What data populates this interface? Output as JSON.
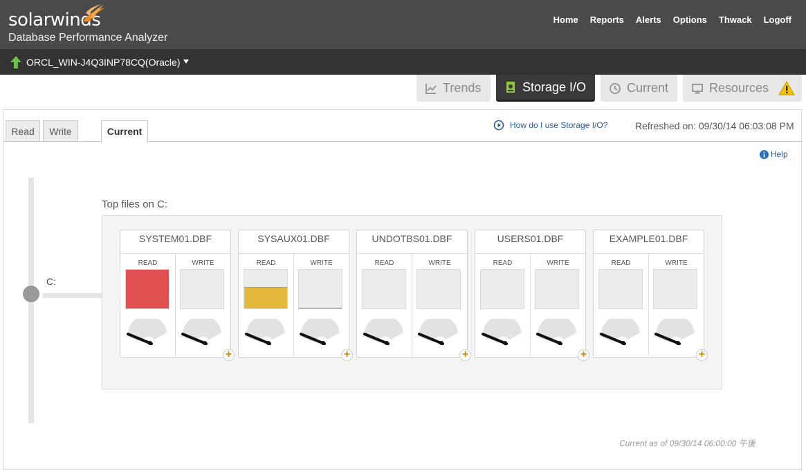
{
  "header": {
    "logo_text": "solarwinds",
    "app_name": "Database Performance Analyzer",
    "nav": [
      "Home",
      "Reports",
      "Alerts",
      "Options",
      "Thwack",
      "Logoff"
    ]
  },
  "server": {
    "name": "ORCL_WIN-J4Q3INP78CQ(Oracle)"
  },
  "main_tabs": {
    "trends": "Trends",
    "storage": "Storage I/O",
    "current": "Current",
    "resources": "Resources"
  },
  "sub_tabs": {
    "read": "Read",
    "write": "Write",
    "current": "Current"
  },
  "howto_link": "How do I use Storage I/O?",
  "refreshed": "Refreshed on: 09/30/14 06:03:08 PM",
  "help": "Help",
  "drive": {
    "label": "C:",
    "files_title": "Top files on C:"
  },
  "labels": {
    "read": "READ",
    "write": "WRITE"
  },
  "files": [
    {
      "name": "SYSTEM01.DBF",
      "read_level": 1.0,
      "read_color": "#e05050",
      "write_level": 0,
      "write_color": "#e05050"
    },
    {
      "name": "SYSAUX01.DBF",
      "read_level": 0.55,
      "read_color": "#e4b83a",
      "write_level": 0.02,
      "write_color": "#4caf50"
    },
    {
      "name": "UNDOTBS01.DBF",
      "read_level": 0,
      "read_color": "#e05050",
      "write_level": 0,
      "write_color": "#e05050"
    },
    {
      "name": "USERS01.DBF",
      "read_level": 0,
      "read_color": "#e05050",
      "write_level": 0,
      "write_color": "#e05050"
    },
    {
      "name": "EXAMPLE01.DBF",
      "read_level": 0,
      "read_color": "#e05050",
      "write_level": 0,
      "write_color": "#e05050"
    }
  ],
  "footer": {
    "current_as": "Current as of 09/30/14 06:00:00 午後"
  },
  "colors": {
    "header": "#4a4a4a",
    "serverbar": "#333333",
    "link": "#2a5c99",
    "accent": "#e8871e"
  }
}
